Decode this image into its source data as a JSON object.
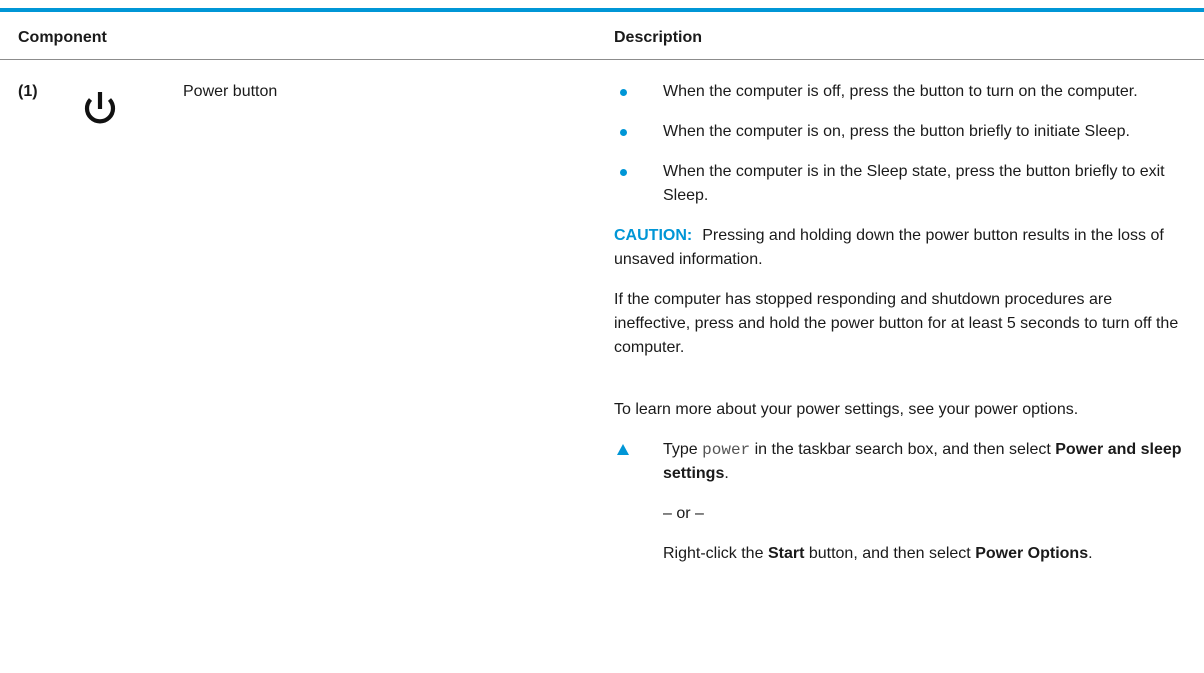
{
  "table": {
    "header": {
      "component_label": "Component",
      "description_label": "Description"
    },
    "row": {
      "callout": "(1)",
      "icon": "power-icon",
      "component_name": "Power button",
      "bullets": [
        "When the computer is off, press the button to turn on the computer.",
        "When the computer is on, press the button briefly to initiate Sleep.",
        "When the computer is in the Sleep state, press the button briefly to exit Sleep."
      ],
      "caution": {
        "label": "CAUTION:",
        "text": "Pressing and holding down the power button results in the loss of unsaved information."
      },
      "shutdown_text": "If the computer has stopped responding and shutdown procedures are ineffective, press and hold the power button for at least 5 seconds to turn off the computer.",
      "learn_more_text": "To learn more about your power settings, see your power options.",
      "step": {
        "prefix": "Type",
        "command": "power",
        "middle": "in the taskbar search box, and then select",
        "bold": "Power and sleep settings",
        "suffix": "."
      },
      "or_text": "– or –",
      "alternative": {
        "prefix": "Right-click the",
        "bold1": "Start",
        "middle": "button, and then select",
        "bold2": "Power Options",
        "suffix": "."
      }
    }
  },
  "colors": {
    "accent": "#0096d6",
    "text": "#1a1a1a",
    "rule": "#8c8c8c"
  }
}
